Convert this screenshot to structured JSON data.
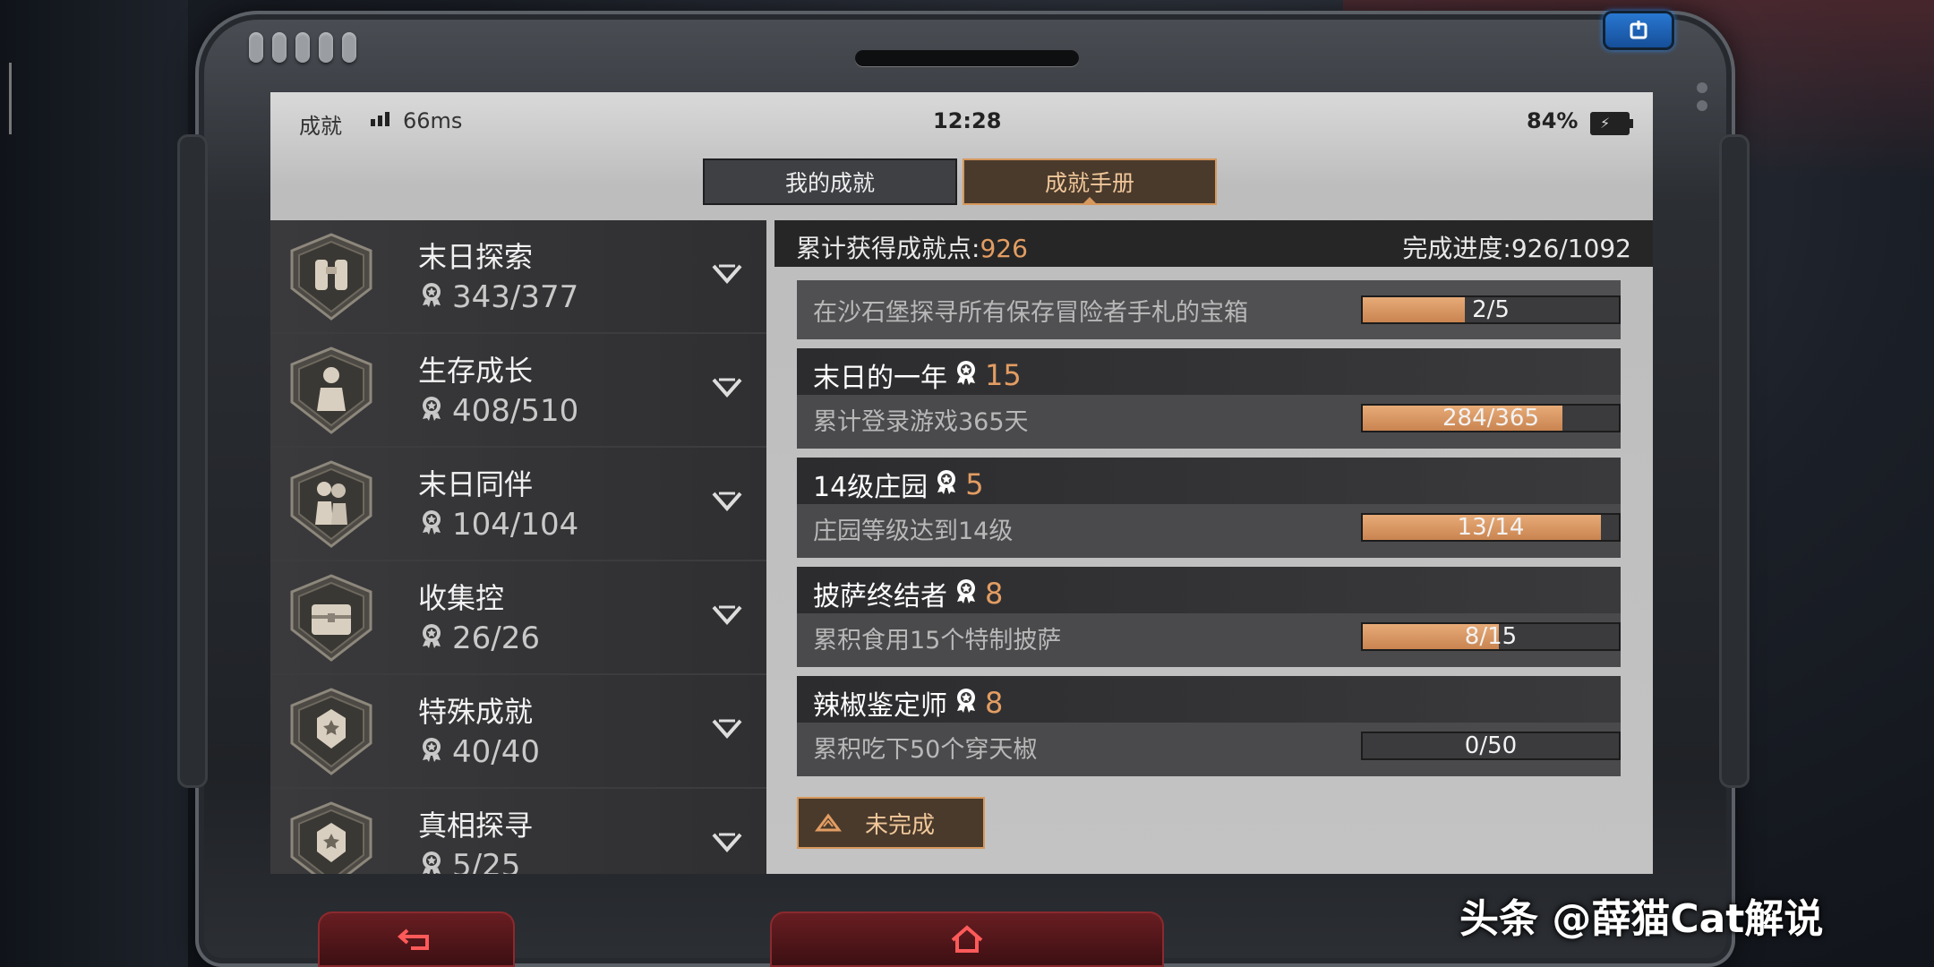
{
  "status": {
    "title": "成就",
    "ping": "66ms",
    "time": "12:28",
    "battery": "84%"
  },
  "tabs": [
    {
      "label": "我的成就",
      "active": false
    },
    {
      "label": "成就手册",
      "active": true
    }
  ],
  "categories": [
    {
      "name": "末日探索",
      "progress": "343/377",
      "icon": "binoculars-emblem-icon"
    },
    {
      "name": "生存成长",
      "progress": "408/510",
      "icon": "survivor-emblem-icon"
    },
    {
      "name": "末日同伴",
      "progress": "104/104",
      "icon": "companions-emblem-icon"
    },
    {
      "name": "收集控",
      "progress": "26/26",
      "icon": "chest-emblem-icon"
    },
    {
      "name": "特殊成就",
      "progress": "40/40",
      "icon": "star-shield-emblem-icon"
    },
    {
      "name": "真相探寻",
      "progress": "5/25",
      "icon": "star-shield-emblem-icon"
    }
  ],
  "summary": {
    "points_label": "累计获得成就点:",
    "points_value": "926",
    "completion_label": "完成进度:",
    "completion_value": "926/1092"
  },
  "achievements": [
    {
      "title": "",
      "points": "",
      "desc": "在沙石堡探寻所有保存冒险者手札的宝箱",
      "progress": "2/5",
      "fraction": 0.4
    },
    {
      "title": "末日的一年",
      "points": "15",
      "desc": "累计登录游戏365天",
      "progress": "284/365",
      "fraction": 0.778
    },
    {
      "title": "14级庄园",
      "points": "5",
      "desc": "庄园等级达到14级",
      "progress": "13/14",
      "fraction": 0.929
    },
    {
      "title": "披萨终结者",
      "points": "8",
      "desc": "累积食用15个特制披萨",
      "progress": "8/15",
      "fraction": 0.533
    },
    {
      "title": "辣椒鉴定师",
      "points": "8",
      "desc": "累积吃下50个穿天椒",
      "progress": "0/50",
      "fraction": 0
    }
  ],
  "filter_button": {
    "label": "未完成"
  },
  "watermark": "头条 @薛猫Cat解说",
  "colors": {
    "accent": "#e39d62",
    "power": "#2a7bd6",
    "nav": "#6a1e22"
  }
}
